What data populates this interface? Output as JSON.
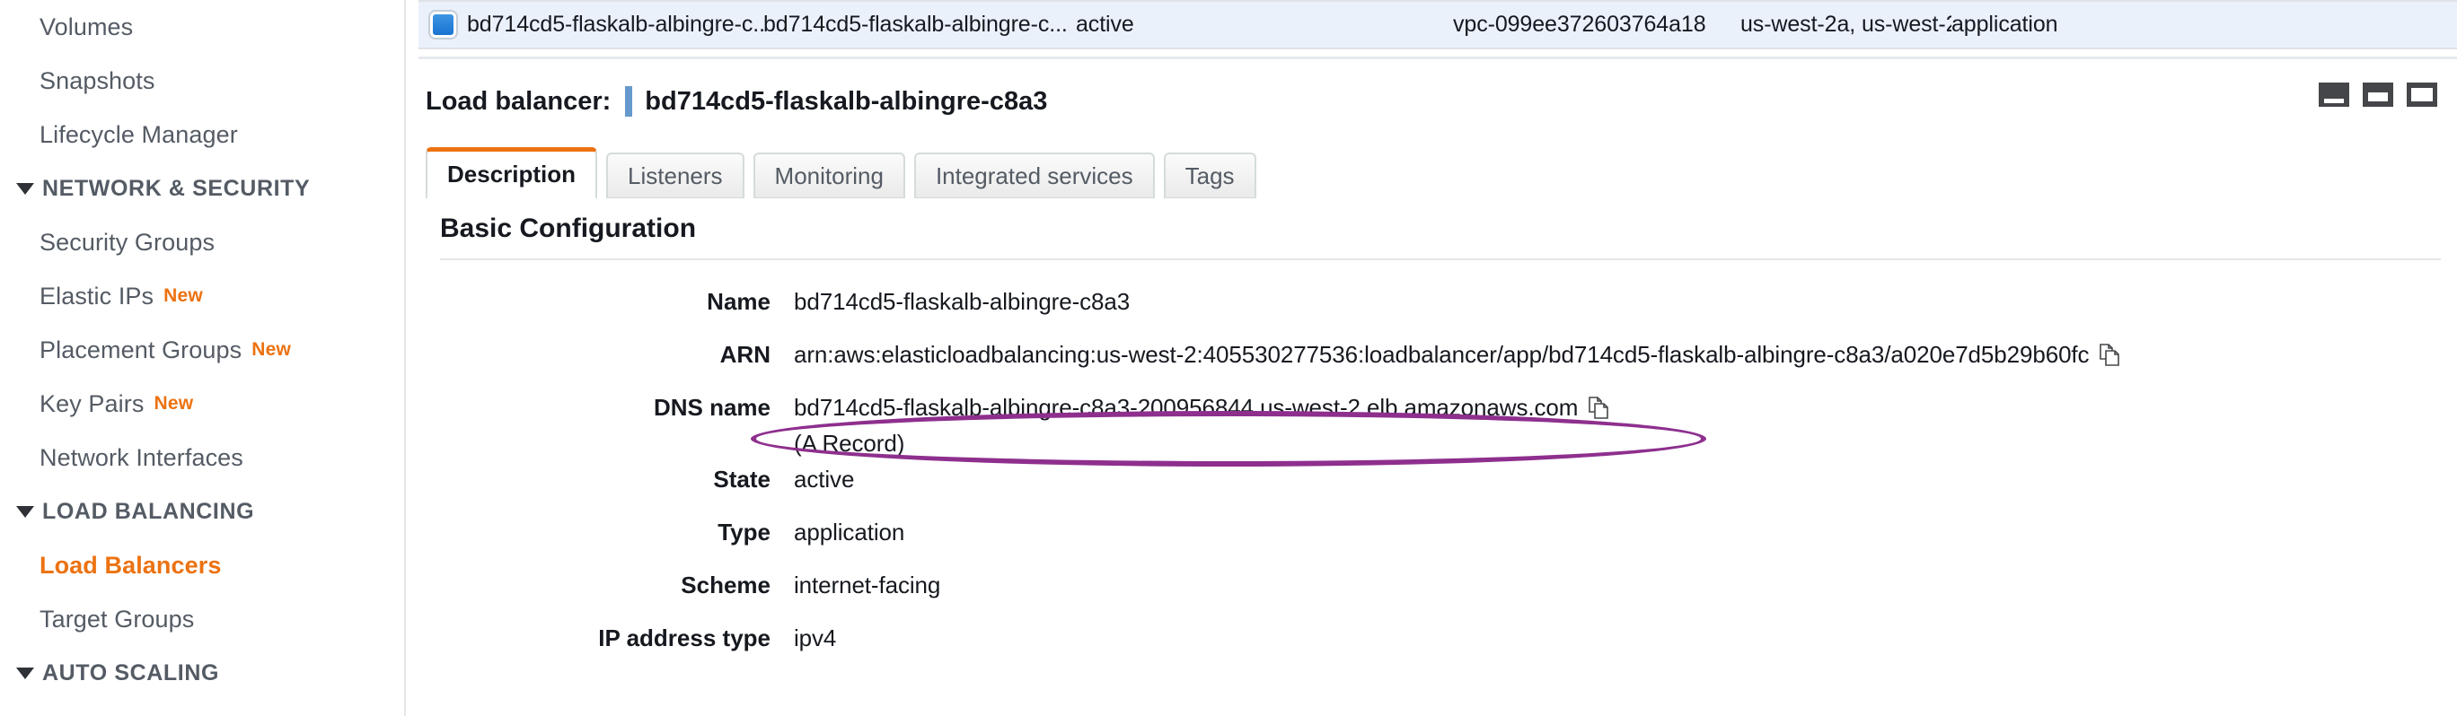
{
  "sidebar": {
    "items": [
      {
        "type": "link",
        "label": "Volumes",
        "badge": null,
        "selected": false
      },
      {
        "type": "link",
        "label": "Snapshots",
        "badge": null,
        "selected": false
      },
      {
        "type": "link",
        "label": "Lifecycle Manager",
        "badge": null,
        "selected": false
      },
      {
        "type": "group",
        "label": "NETWORK & SECURITY",
        "badge": null,
        "selected": false
      },
      {
        "type": "link",
        "label": "Security Groups",
        "badge": null,
        "selected": false
      },
      {
        "type": "link",
        "label": "Elastic IPs",
        "badge": "New",
        "selected": false
      },
      {
        "type": "link",
        "label": "Placement Groups",
        "badge": "New",
        "selected": false
      },
      {
        "type": "link",
        "label": "Key Pairs",
        "badge": "New",
        "selected": false
      },
      {
        "type": "link",
        "label": "Network Interfaces",
        "badge": null,
        "selected": false
      },
      {
        "type": "group",
        "label": "LOAD BALANCING",
        "badge": null,
        "selected": false
      },
      {
        "type": "link",
        "label": "Load Balancers",
        "badge": null,
        "selected": true
      },
      {
        "type": "link",
        "label": "Target Groups",
        "badge": null,
        "selected": false
      },
      {
        "type": "group",
        "label": "AUTO SCALING",
        "badge": null,
        "selected": false
      }
    ]
  },
  "table": {
    "selected_row": {
      "checkbox_checked": true,
      "name": "bd714cd5-flaskalb-albingre-c...",
      "dns_name": "bd714cd5-flaskalb-albingre-c...",
      "state": "active",
      "vpc_id": "vpc-099ee372603764a18",
      "availability_zones": "us-west-2a, us-west-2b...",
      "type": "application"
    }
  },
  "detail": {
    "header_label": "Load balancer:",
    "header_title": "bd714cd5-flaskalb-albingre-c8a3",
    "panel_size_icons": [
      "panel-small-icon",
      "panel-medium-icon",
      "panel-large-icon"
    ],
    "tabs": [
      {
        "label": "Description",
        "active": true
      },
      {
        "label": "Listeners",
        "active": false
      },
      {
        "label": "Monitoring",
        "active": false
      },
      {
        "label": "Integrated services",
        "active": false
      },
      {
        "label": "Tags",
        "active": false
      }
    ],
    "section_title": "Basic Configuration",
    "fields": [
      {
        "label": "Name",
        "value": "bd714cd5-flaskalb-albingre-c8a3",
        "sub": null,
        "copy": false,
        "annotated": false
      },
      {
        "label": "ARN",
        "value": "arn:aws:elasticloadbalancing:us-west-2:405530277536:loadbalancer/app/bd714cd5-flaskalb-albingre-c8a3/a020e7d5b29b60fc",
        "sub": null,
        "copy": true,
        "annotated": false
      },
      {
        "label": "DNS name",
        "value": "bd714cd5-flaskalb-albingre-c8a3-200956844.us-west-2.elb.amazonaws.com",
        "sub": "(A Record)",
        "copy": true,
        "annotated": true
      },
      {
        "label": "State",
        "value": "active",
        "sub": null,
        "copy": false,
        "annotated": false
      },
      {
        "label": "Type",
        "value": "application",
        "sub": null,
        "copy": false,
        "annotated": false
      },
      {
        "label": "Scheme",
        "value": "internet-facing",
        "sub": null,
        "copy": false,
        "annotated": false
      },
      {
        "label": "IP address type",
        "value": "ipv4",
        "sub": null,
        "copy": false,
        "annotated": false
      }
    ]
  },
  "annotation": {
    "shape": "ellipse",
    "color": "#8e2f8e",
    "targets": "DNS name value"
  },
  "colors": {
    "accent_orange": "#ec7211",
    "selected_row_blue": "#eaf1fb",
    "title_bar_blue": "#6699cc",
    "text": "#16191f",
    "muted_text": "#545b64",
    "annotation_purple": "#8e2f8e"
  }
}
